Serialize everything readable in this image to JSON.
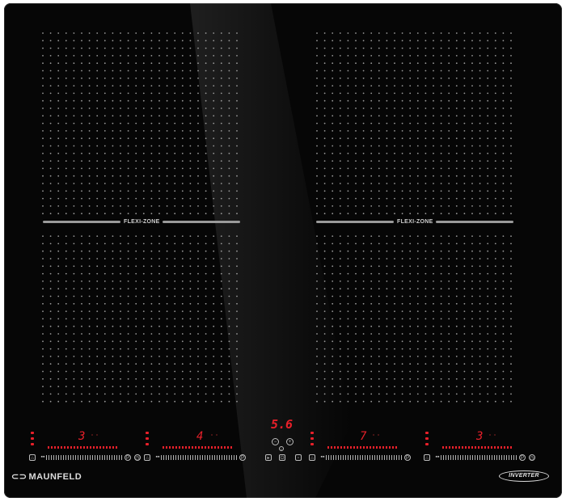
{
  "brand": {
    "name": "MAUNFELD",
    "logo_icon": "maunfeld-logo-icon"
  },
  "badge": {
    "label": "INVERTER"
  },
  "flexi_zones": [
    {
      "label": "FLEXI-ZONE"
    },
    {
      "label": "FLEXI-ZONE"
    }
  ],
  "cooking_zones": [
    {
      "power_level": "3"
    },
    {
      "power_level": "4"
    },
    {
      "power_level": "7"
    },
    {
      "power_level": "3"
    }
  ],
  "timer": {
    "display": "5.6"
  },
  "colors": {
    "glass": "#060606",
    "display_red": "#e8202a",
    "print": "#bdbdbd"
  }
}
